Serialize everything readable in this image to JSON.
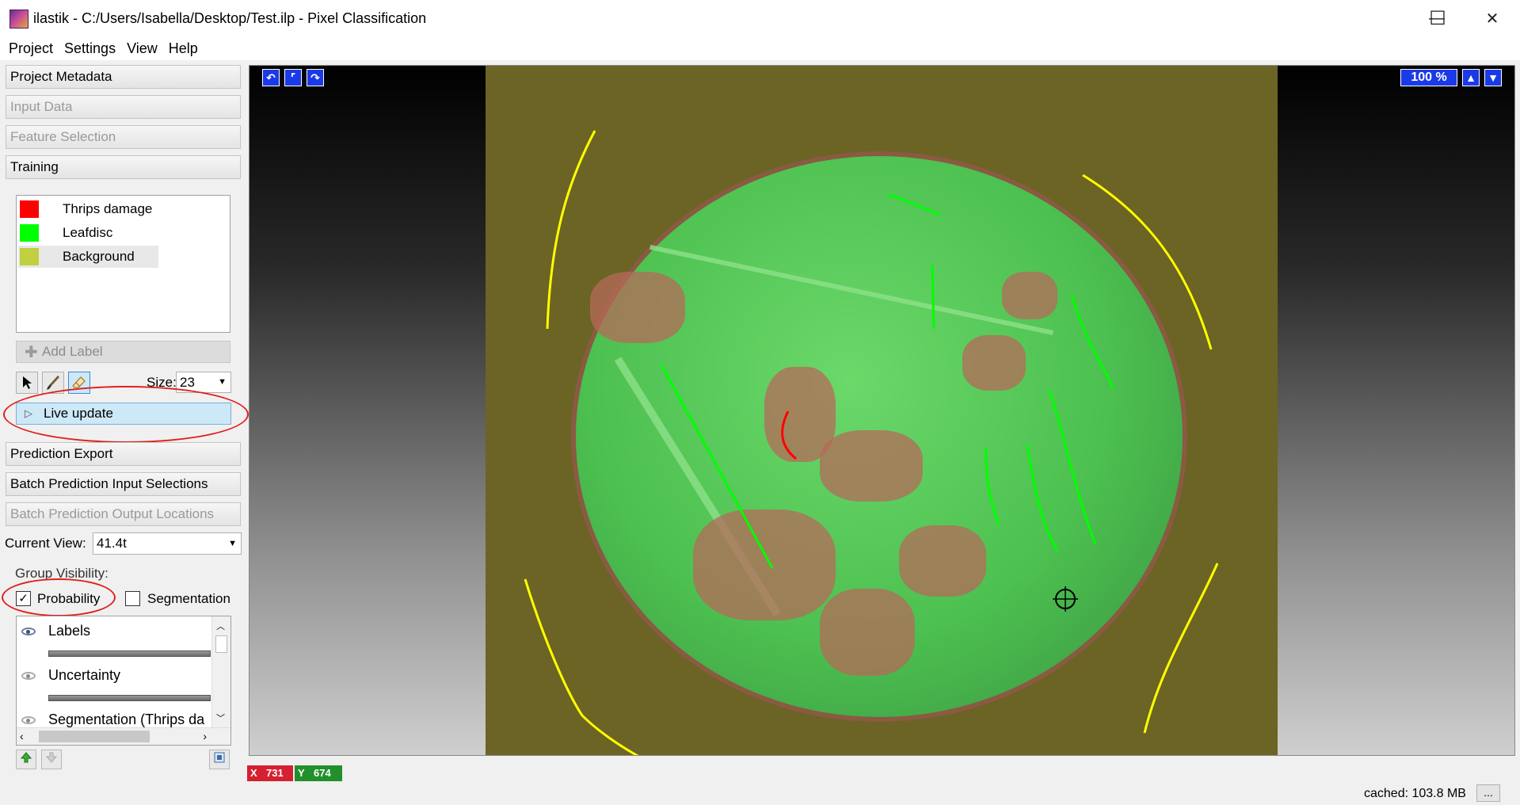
{
  "window": {
    "title": "ilastik - C:/Users/Isabella/Desktop/Test.ilp - Pixel Classification",
    "minimize": "—",
    "maximize": "☐",
    "close": "✕"
  },
  "menu": [
    "Project",
    "Settings",
    "View",
    "Help"
  ],
  "applets": {
    "project_metadata": "Project Metadata",
    "input_data": "Input Data",
    "feature_selection": "Feature Selection",
    "training": "Training",
    "prediction_export": "Prediction Export",
    "batch_input": "Batch Prediction Input Selections",
    "batch_output": "Batch Prediction Output Locations"
  },
  "labels": [
    {
      "name": "Thrips damage",
      "color": "#ff0000"
    },
    {
      "name": "Leafdisc",
      "color": "#00ff00"
    },
    {
      "name": "Background",
      "color": "#c0d040"
    }
  ],
  "toolbar": {
    "add_label": "Add Label",
    "size_label": "Size:",
    "size_value": "23",
    "live_update": "Live update",
    "icons": [
      "pointer-icon",
      "brush-icon",
      "eraser-icon"
    ]
  },
  "view": {
    "current_view_label": "Current View:",
    "current_view_value": "41.4t",
    "group_visibility": "Group Visibility:",
    "probability": "Probability",
    "probability_checked": true,
    "segmentation": "Segmentation",
    "segmentation_checked": false,
    "check_mark": "✓"
  },
  "layers": [
    {
      "name": "Labels",
      "visible": true
    },
    {
      "name": "Uncertainty",
      "visible": false
    },
    {
      "name": "Segmentation (Thrips da",
      "visible": false
    }
  ],
  "viewer": {
    "zoom": "100 %",
    "up_arrow": "▲",
    "down_arrow": "▼",
    "undo": "↶",
    "home": "⌜",
    "redo": "↷"
  },
  "coords": {
    "x_label": "X",
    "x_value": "731",
    "y_label": "Y",
    "y_value": "674"
  },
  "status": {
    "cached": "cached: 103.8 MB",
    "more": "..."
  },
  "colors": {
    "coord_x_bg": "#d42030",
    "coord_y_bg": "#20902a",
    "annotation": "#e0201a",
    "accent_blue": "#1a3ae8"
  }
}
